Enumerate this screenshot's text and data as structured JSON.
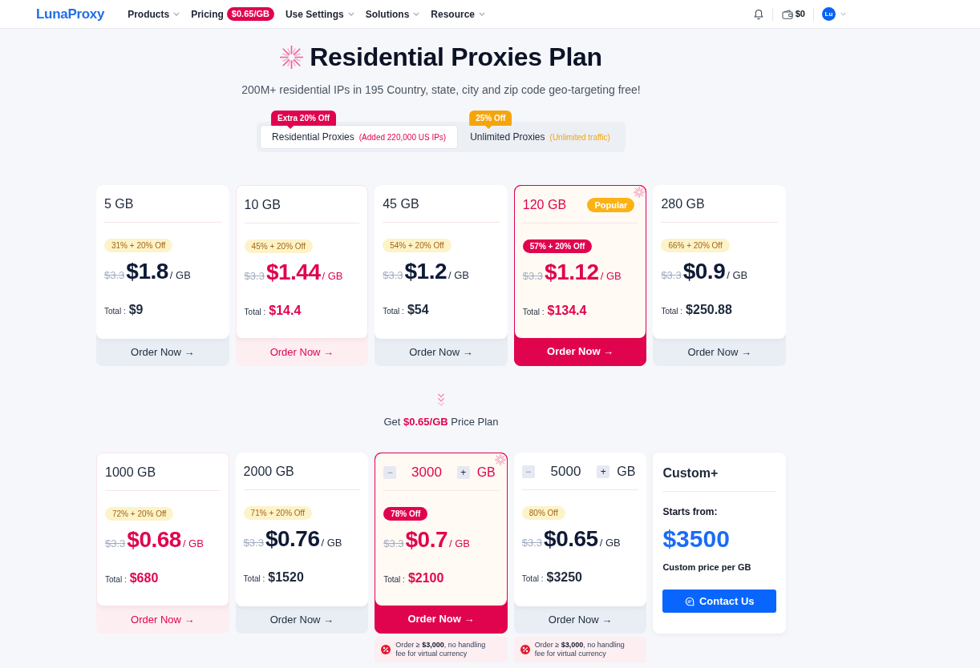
{
  "nav": {
    "logo": "LunaProxy",
    "items": [
      {
        "label": "Products",
        "dropdown": true
      },
      {
        "label": "Pricing",
        "badge": "$0.65/GB",
        "dropdown": false
      },
      {
        "label": "Use Settings",
        "dropdown": true
      },
      {
        "label": "Solutions",
        "dropdown": true
      },
      {
        "label": "Resource",
        "dropdown": true
      }
    ],
    "balance": "$0",
    "avatar": "Lu"
  },
  "hero": {
    "title": "Residential Proxies Plan",
    "subtitle": "200M+ residential IPs in 195 Country, state, city and zip code geo-targeting free!"
  },
  "tabs": [
    {
      "label": "Residential Proxies",
      "note": "(Added 220,000 US IPs)",
      "badge": "Extra 20% Off",
      "color": "#e0044f",
      "selected": true
    },
    {
      "label": "Unlimited Proxies",
      "note": "(Unlimited traffic)",
      "badge": "25% Off",
      "color": "#f5a50c",
      "selected": false
    }
  ],
  "plans": [
    {
      "size": "5 GB",
      "discount": "31% + 20% Off",
      "old_price": "$3.3",
      "price": "$1.8",
      "unit": "/ GB",
      "total_label": "Total :",
      "total": "$9",
      "order": "Order Now →",
      "accent": false,
      "selected": false
    },
    {
      "size": "10 GB",
      "discount": "45% + 20% Off",
      "old_price": "$3.3",
      "price": "$1.44",
      "unit": "/ GB",
      "total_label": "Total :",
      "total": "$14.4",
      "order": "Order Now →",
      "accent": true,
      "selected": false
    },
    {
      "size": "45 GB",
      "discount": "54% + 20% Off",
      "old_price": "$3.3",
      "price": "$1.2",
      "unit": "/ GB",
      "total_label": "Total :",
      "total": "$54",
      "order": "Order Now →",
      "accent": false,
      "selected": false
    },
    {
      "size": "120 GB",
      "badge": "Popular",
      "discount": "57% + 20% Off",
      "old_price": "$3.3",
      "price": "$1.12",
      "unit": "/ GB",
      "total_label": "Total :",
      "total": "$134.4",
      "order": "Order Now →",
      "accent": true,
      "selected": true
    },
    {
      "size": "280 GB",
      "discount": "66% + 20% Off",
      "old_price": "$3.3",
      "price": "$0.9",
      "unit": "/ GB",
      "total_label": "Total :",
      "total": "$250.88",
      "order": "Order Now →",
      "accent": false,
      "selected": false
    }
  ],
  "price_plan_text": "Get **$0.65/GB** Price Plan",
  "bulk_plans": [
    {
      "kind": "fixed",
      "size": "1000 GB",
      "discount": "72% + 20% Off",
      "old_price": "$3.3",
      "price": "$0.68",
      "unit": "/ GB",
      "total_label": "Total :",
      "total": "$680",
      "order": "Order Now →",
      "accent": true,
      "selected": false
    },
    {
      "kind": "fixed",
      "size": "2000 GB",
      "discount": "71% + 20% Off",
      "old_price": "$3.3",
      "price": "$0.76",
      "unit": "/ GB",
      "total_label": "Total :",
      "total": "$1520",
      "order": "Order Now →",
      "accent": false,
      "selected": false
    },
    {
      "kind": "stepper",
      "minus": "−",
      "quantity": "3000",
      "plus": "+",
      "quantity_unit": "GB",
      "discount": "78% Off",
      "old_price": "$3.3",
      "price": "$0.7",
      "unit": "/ GB",
      "total_label": "Total :",
      "total": "$2100",
      "order": "Order Now →",
      "note": "Order ≥ **$3,000**, no handling fee for virtual currency",
      "accent": true,
      "selected": true
    },
    {
      "kind": "stepper",
      "minus": "−",
      "quantity": "5000",
      "plus": "+",
      "quantity_unit": "GB",
      "discount": "80% Off",
      "old_price": "$3.3",
      "price": "$0.65",
      "unit": "/ GB",
      "total_label": "Total :",
      "total": "$3250",
      "order": "Order Now →",
      "note": "Order ≥ **$3,000**, no handling fee for virtual currency",
      "accent": false,
      "selected": false
    },
    {
      "kind": "custom",
      "title": "Custom+",
      "label": "Starts from:",
      "price": "$3500",
      "caption": "Custom price per GB",
      "button": "Contact Us"
    }
  ]
}
